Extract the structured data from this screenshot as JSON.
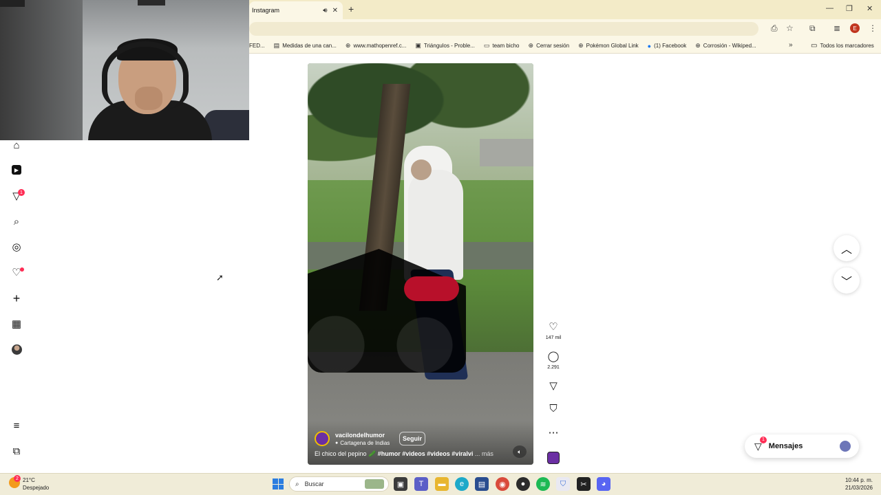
{
  "browser": {
    "tab_title": "Instagram",
    "tab_audio_icon": "speaker-icon",
    "new_tab": "+",
    "window_controls": [
      "minimize",
      "restore",
      "close"
    ],
    "bookmarks": [
      {
        "label": "FED...",
        "icon": "page-icon"
      },
      {
        "label": "Medidas de una can...",
        "icon": "bookmark-icon"
      },
      {
        "label": "www.mathopenref.c...",
        "icon": "globe-icon"
      },
      {
        "label": "Triángulos - Proble...",
        "icon": "bookmark-icon"
      },
      {
        "label": "team bicho",
        "icon": "page-icon"
      },
      {
        "label": "Cerrar sesión",
        "icon": "globe-icon"
      },
      {
        "label": "Pokémon Global Link",
        "icon": "globe-icon"
      },
      {
        "label": "(1) Facebook",
        "icon": "facebook-icon"
      },
      {
        "label": "Corrosión - Wikiped...",
        "icon": "globe-icon"
      }
    ],
    "bookmarks_overflow": "»",
    "all_bookmarks": "Todos los marcadores",
    "profile_initial": "E"
  },
  "sidebar": {
    "items": [
      {
        "name": "home-icon",
        "glyph": "⌂"
      },
      {
        "name": "reels-icon",
        "glyph": "▶"
      },
      {
        "name": "direct-icon",
        "glyph": "▽",
        "badge": "1"
      },
      {
        "name": "search-icon",
        "glyph": "⌕"
      },
      {
        "name": "explore-icon",
        "glyph": "◎"
      },
      {
        "name": "heart-icon",
        "glyph": "♡",
        "dot": true
      },
      {
        "name": "create-icon",
        "glyph": "+"
      },
      {
        "name": "dashboard-icon",
        "glyph": "▦"
      }
    ],
    "more_glyph": "≡",
    "meta_glyph": "⧉"
  },
  "reel": {
    "author": "vacilondelhumor",
    "location": "Cartagena de Indias",
    "follow_label": "Seguir",
    "caption_text": "El chico del pepino ",
    "caption_tags": "🥒 #humor #videos #videos #viralvi",
    "caption_more": "... más",
    "likes": "147 mil",
    "comments": "2.291"
  },
  "messages": {
    "label": "Mensajes",
    "badge": "1"
  },
  "taskbar": {
    "weather_badge": "2",
    "temperature": "21°C",
    "weather_desc": "Despejado",
    "search_placeholder": "Buscar",
    "time": "10:44 p. m.",
    "date": "21/03/2026"
  },
  "colors": {
    "chrome_bg": "#f3ebc8",
    "instagram_badge": "#ff2d55",
    "taskbar_bg": "#f0ecd8"
  }
}
